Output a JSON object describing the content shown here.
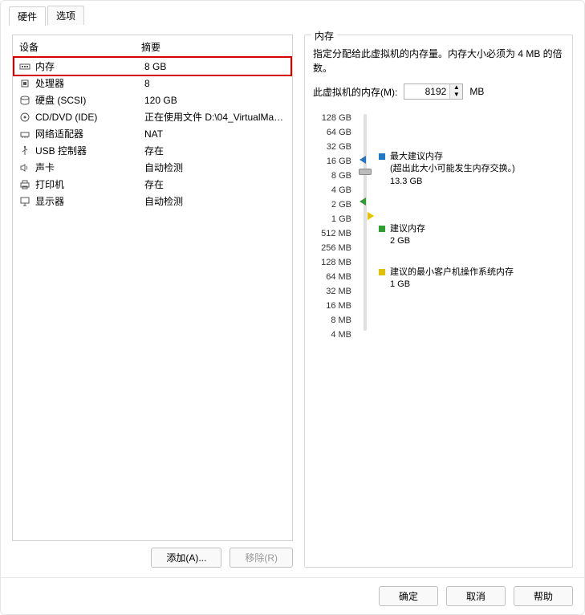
{
  "tabs": {
    "hardware": "硬件",
    "options": "选项"
  },
  "headers": {
    "device": "设备",
    "summary": "摘要"
  },
  "devices": [
    {
      "icon": "memory",
      "name": "内存",
      "summary": "8 GB",
      "hl": true
    },
    {
      "icon": "cpu",
      "name": "处理器",
      "summary": "8"
    },
    {
      "icon": "disk",
      "name": "硬盘 (SCSI)",
      "summary": "120 GB"
    },
    {
      "icon": "cd",
      "name": "CD/DVD (IDE)",
      "summary": "正在使用文件 D:\\04_VirtualMac..."
    },
    {
      "icon": "net",
      "name": "网络适配器",
      "summary": "NAT"
    },
    {
      "icon": "usb",
      "name": "USB 控制器",
      "summary": "存在"
    },
    {
      "icon": "sound",
      "name": "声卡",
      "summary": "自动检测"
    },
    {
      "icon": "printer",
      "name": "打印机",
      "summary": "存在"
    },
    {
      "icon": "display",
      "name": "显示器",
      "summary": "自动检测"
    }
  ],
  "left_buttons": {
    "add": "添加(A)...",
    "remove": "移除(R)"
  },
  "memory": {
    "group_title": "内存",
    "desc": "指定分配给此虚拟机的内存量。内存大小必须为 4 MB 的倍数。",
    "label": "此虚拟机的内存(M):",
    "value": "8192",
    "unit": "MB",
    "ticks": [
      "128 GB",
      "64 GB",
      "32 GB",
      "16 GB",
      "8 GB",
      "4 GB",
      "2 GB",
      "1 GB",
      "512 MB",
      "256 MB",
      "128 MB",
      "64 MB",
      "32 MB",
      "16 MB",
      "8 MB",
      "4 MB"
    ],
    "legend": {
      "max": {
        "title": "最大建议内存",
        "note": "(超出此大小可能发生内存交换。)",
        "value": "13.3 GB",
        "color": "#1f77c9"
      },
      "rec": {
        "title": "建议内存",
        "value": "2 GB",
        "color": "#2e9e2e"
      },
      "min": {
        "title": "建议的最小客户机操作系统内存",
        "value": "1 GB",
        "color": "#e0c000"
      }
    }
  },
  "footer": {
    "ok": "确定",
    "cancel": "取消",
    "help": "帮助"
  }
}
